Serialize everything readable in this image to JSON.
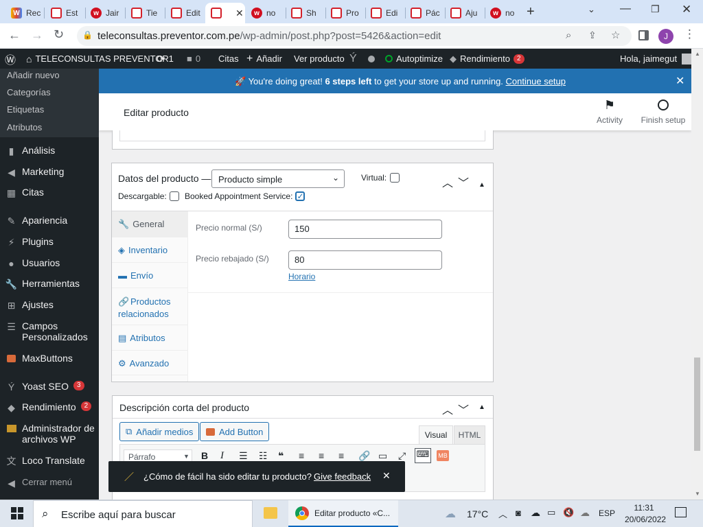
{
  "browser": {
    "tabs": [
      {
        "label": "Rec",
        "icon": "colorful-logo-icon"
      },
      {
        "label": "Est",
        "icon": "preventor-icon"
      },
      {
        "label": "Jair",
        "icon": "red-circle-icon"
      },
      {
        "label": "Tie",
        "icon": "preventor-icon"
      },
      {
        "label": "Edit",
        "icon": "preventor-icon"
      },
      {
        "label": "",
        "icon": "preventor-icon",
        "active": true
      },
      {
        "label": "no",
        "icon": "red-circle-icon"
      },
      {
        "label": "Sh",
        "icon": "preventor-icon"
      },
      {
        "label": "Pro",
        "icon": "preventor-icon"
      },
      {
        "label": "Edi",
        "icon": "preventor-icon"
      },
      {
        "label": "Pác",
        "icon": "preventor-icon"
      },
      {
        "label": "Aju",
        "icon": "preventor-icon"
      },
      {
        "label": "no",
        "icon": "red-circle-icon"
      }
    ],
    "url": "teleconsultas.preventor.com.pe/wp-admin/post.php?post=5426&action=edit",
    "url_domain": "teleconsultas.preventor.com.pe",
    "url_path": "/wp-admin/post.php?post=5426&action=edit",
    "profile_initial": "J"
  },
  "adminbar": {
    "site_name": "TELECONSULTAS PREVENTOR",
    "updates_count": "1",
    "comments_count": "0",
    "citas": "Citas",
    "add_new": "Añadir",
    "view_product": "Ver producto",
    "autoptimize": "Autoptimize",
    "rendimiento": "Rendimiento",
    "rendimiento_badge": "2",
    "greeting": "Hola, jaimegut"
  },
  "sidebar": {
    "submenu": [
      "Añadir nuevo",
      "Categorías",
      "Etiquetas",
      "Atributos"
    ],
    "items": [
      {
        "label": "Análisis",
        "icon": "bar-chart-icon"
      },
      {
        "label": "Marketing",
        "icon": "megaphone-icon"
      },
      {
        "label": "Citas",
        "icon": "calendar-icon"
      },
      {
        "label": "Apariencia",
        "icon": "paintbrush-icon"
      },
      {
        "label": "Plugins",
        "icon": "plug-icon"
      },
      {
        "label": "Usuarios",
        "icon": "user-icon"
      },
      {
        "label": "Herramientas",
        "icon": "wrench-icon"
      },
      {
        "label": "Ajustes",
        "icon": "settings-sliders-icon"
      },
      {
        "label": "Campos Personalizados",
        "icon": "table-icon"
      },
      {
        "label": "MaxButtons",
        "icon": "maxbuttons-icon"
      },
      {
        "label": "Yoast SEO",
        "icon": "yoast-icon",
        "badge": "3"
      },
      {
        "label": "Rendimiento",
        "icon": "gauge-icon",
        "badge": "2"
      },
      {
        "label": "Administrador de archivos WP",
        "icon": "folder-icon"
      },
      {
        "label": "Loco Translate",
        "icon": "translate-icon"
      },
      {
        "label": "Cerrar menú",
        "icon": "collapse-icon"
      }
    ]
  },
  "notice": {
    "prefix": "You're doing great!",
    "bold": "6 steps left",
    "suffix": "to get your store up and running.",
    "link": "Continue setup"
  },
  "header": {
    "title": "Editar producto",
    "activity": "Activity",
    "finish_setup": "Finish setup"
  },
  "product_data": {
    "title": "Datos del producto —",
    "type_selected": "Producto simple",
    "virtual_label": "Virtual:",
    "virtual_checked": false,
    "downloadable_label": "Descargable:",
    "downloadable_checked": false,
    "booked_label": "Booked Appointment Service:",
    "booked_checked": true,
    "tabs": [
      {
        "label": "General",
        "icon": "wrench-icon",
        "active": true
      },
      {
        "label": "Inventario",
        "icon": "tag-icon"
      },
      {
        "label": "Envío",
        "icon": "truck-icon"
      },
      {
        "label": "Productos relacionados",
        "icon": "link-icon"
      },
      {
        "label": "Atributos",
        "icon": "list-icon"
      },
      {
        "label": "Avanzado",
        "icon": "gear-icon"
      }
    ],
    "regular_price_label": "Precio normal (S/)",
    "regular_price": "150",
    "sale_price_label": "Precio rebajado (S/)",
    "sale_price": "80",
    "schedule_link": "Horario"
  },
  "short_description": {
    "title": "Descripción corta del producto",
    "add_media": "Añadir medios",
    "add_button": "Add Button",
    "tab_visual": "Visual",
    "tab_html": "HTML",
    "format_select": "Párrafo"
  },
  "feedback": {
    "question": "¿Cómo de fácil ha sido editar tu producto?",
    "link": "Give feedback"
  },
  "taskbar": {
    "search_placeholder": "Escribe aquí para buscar",
    "chrome_window": "Editar producto «C...",
    "temperature": "17°C",
    "language": "ESP",
    "time": "11:31",
    "date": "20/06/2022"
  }
}
